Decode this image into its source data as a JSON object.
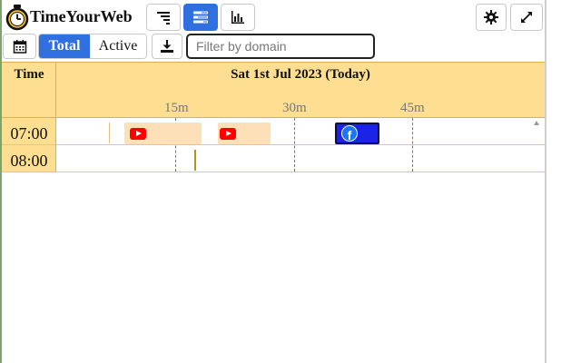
{
  "app": {
    "title": "TimeYourWeb"
  },
  "toolbar": {
    "view_buttons": [
      "timeline-icon",
      "list-icon",
      "bar-chart-icon"
    ],
    "selected_view_index": 1,
    "settings_icon": "gear-icon",
    "expand_icon": "expand-icon"
  },
  "controls": {
    "calendar_icon": "calendar-icon",
    "total_label": "Total",
    "active_label": "Active",
    "download_icon": "download-icon",
    "filter_placeholder": "Filter by domain",
    "filter_value": ""
  },
  "timeline": {
    "time_header": "Time",
    "date_header": "Sat 1st Jul 2023 (Today)",
    "ticks": [
      "15m",
      "30m",
      "45m"
    ],
    "rows": [
      {
        "label": "07:00"
      },
      {
        "label": "08:00"
      }
    ],
    "sessions": [
      {
        "site": "youtube",
        "icon": "youtube-icon"
      },
      {
        "site": "youtube",
        "icon": "youtube-icon"
      },
      {
        "site": "facebook",
        "icon": "facebook-icon",
        "icon_text": "f"
      }
    ]
  },
  "colors": {
    "accent": "#2f6fe0",
    "header_bg": "#fedf92",
    "youtube_block": "#fde0b8",
    "facebook_block": "#1a23e6"
  }
}
